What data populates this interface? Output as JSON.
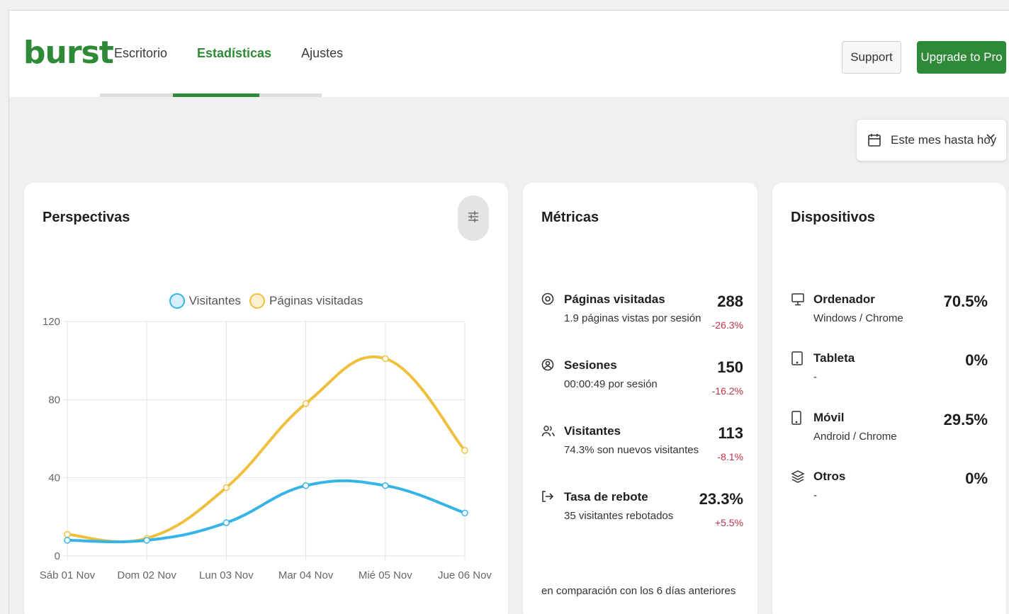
{
  "app": {
    "logo": "burst"
  },
  "nav": {
    "items": [
      {
        "label": "Escritorio"
      },
      {
        "label": "Estadísticas"
      },
      {
        "label": "Ajustes"
      }
    ],
    "active_index": 1
  },
  "header": {
    "support_label": "Support",
    "upgrade_label": "Upgrade to Pro"
  },
  "date_range": {
    "label": "Este mes hasta hoy",
    "icon": "calendar-icon"
  },
  "colors": {
    "brand": "#2e8a37",
    "visitors": "#36b4e8",
    "pageviews": "#efc03e",
    "negative": "#c0334a"
  },
  "insights": {
    "title": "Perspectivas",
    "filter_icon": "sliders-icon",
    "chart_data": {
      "type": "line",
      "x": [
        "Sáb 01 Nov",
        "Dom 02 Nov",
        "Lun 03 Nov",
        "Mar 04 Nov",
        "Mié 05 Nov",
        "Jue 06 Nov"
      ],
      "series": [
        {
          "name": "Visitantes",
          "values": [
            8,
            8,
            17,
            36,
            36,
            22
          ]
        },
        {
          "name": "Páginas visitadas",
          "values": [
            11,
            9,
            35,
            78,
            101,
            54
          ]
        }
      ],
      "yticks": [
        0,
        40,
        80,
        120
      ],
      "ylim": [
        0,
        120
      ],
      "grid": true,
      "legend": "top-center"
    }
  },
  "metrics": {
    "title": "Métricas",
    "rows": [
      {
        "icon": "eye-icon",
        "label": "Páginas visitadas",
        "sub": "1.9 páginas vistas por sesión",
        "value": "288",
        "delta": "-26.3%"
      },
      {
        "icon": "user-circle-icon",
        "label": "Sesiones",
        "sub": "00:00:49 por sesión",
        "value": "150",
        "delta": "-16.2%"
      },
      {
        "icon": "users-icon",
        "label": "Visitantes",
        "sub": "74.3% son nuevos visitantes",
        "value": "113",
        "delta": "-8.1%"
      },
      {
        "icon": "exit-arrow-icon",
        "label": "Tasa de rebote",
        "sub": "35 visitantes rebotados",
        "value": "23.3%",
        "delta": "+5.5%"
      }
    ],
    "compare_note": "en comparación con los 6 días anteriores"
  },
  "devices": {
    "title": "Dispositivos",
    "rows": [
      {
        "icon": "desktop-icon",
        "label": "Ordenador",
        "sub": "Windows / Chrome",
        "value": "70.5%"
      },
      {
        "icon": "tablet-icon",
        "label": "Tableta",
        "sub": "-",
        "value": "0%"
      },
      {
        "icon": "mobile-icon",
        "label": "Móvil",
        "sub": "Android / Chrome",
        "value": "29.5%"
      },
      {
        "icon": "layers-icon",
        "label": "Otros",
        "sub": "-",
        "value": "0%"
      }
    ]
  }
}
